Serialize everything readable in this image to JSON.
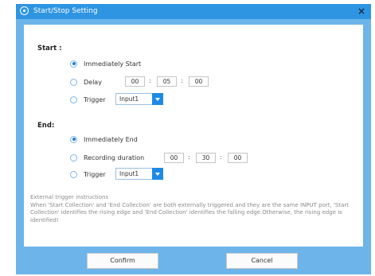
{
  "dialog": {
    "title": "Start/Stop Setting",
    "close_glyph": "×",
    "accent_color": "#2e95e3",
    "icons": [
      "settings-icon",
      "close-icon",
      "chevron-down-icon"
    ]
  },
  "start": {
    "heading": "Start :",
    "options": {
      "immediate": "Immediately Start",
      "delay": "Delay",
      "trigger": "Trigger"
    },
    "selected": "immediate",
    "delay_h": "00",
    "delay_m": "05",
    "delay_s": "00",
    "trigger_value": "Input1"
  },
  "end": {
    "heading": "End:",
    "options": {
      "immediate": "Immediately End",
      "duration": "Recording duration",
      "trigger": "Trigger"
    },
    "selected": "immediate",
    "duration_h": "00",
    "duration_m": "30",
    "duration_s": "00",
    "trigger_value": "Input1"
  },
  "separator": ":",
  "instructions": {
    "title": "External trigger instructions",
    "body": "When 'Start Collection' and 'End Collection' are both externally triggered and they are the same INPUT port, 'Start Collection' identifies the rising edge and 'End Collection' identifies the falling edge.Otherwise, the rising edge is identified!"
  },
  "buttons": {
    "confirm": "Confirm",
    "cancel": "Cancel"
  }
}
